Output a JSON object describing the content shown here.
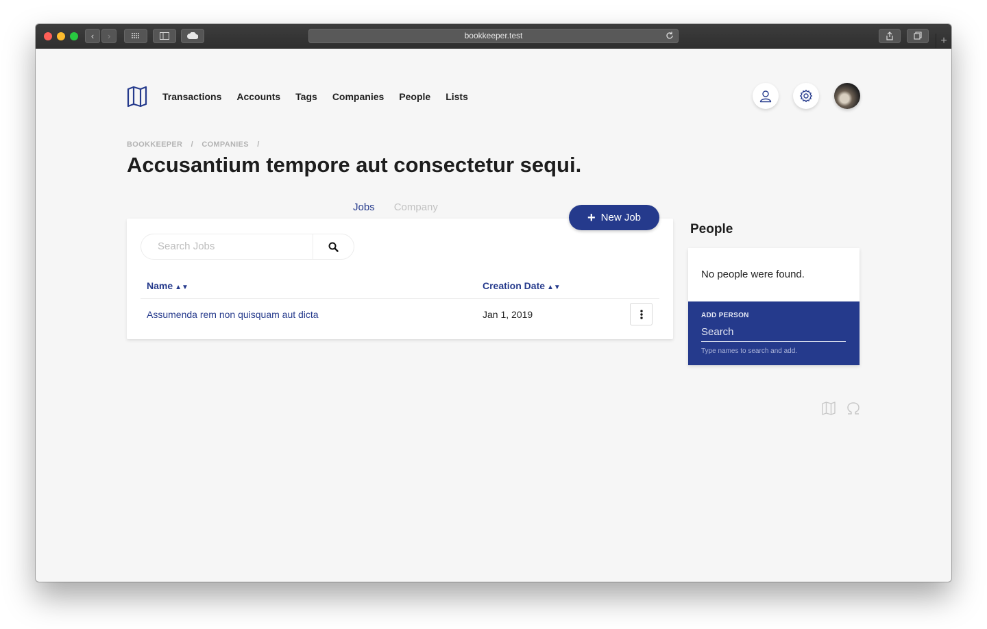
{
  "browser": {
    "url": "bookkeeper.test"
  },
  "nav": {
    "items": [
      "Transactions",
      "Accounts",
      "Tags",
      "Companies",
      "People",
      "Lists"
    ]
  },
  "breadcrumb": [
    "BOOKKEEPER",
    "/",
    "COMPANIES",
    "/"
  ],
  "page": {
    "title": "Accusantium tempore aut consectetur sequi."
  },
  "tabs": {
    "jobs": "Jobs",
    "company": "Company"
  },
  "actions": {
    "new_job": "New Job"
  },
  "jobs": {
    "search_placeholder": "Search Jobs",
    "columns": {
      "name": "Name",
      "creation_date": "Creation Date"
    },
    "rows": [
      {
        "name": "Assumenda rem non quisquam aut dicta",
        "date": "Jan 1, 2019"
      }
    ]
  },
  "people": {
    "title": "People",
    "empty": "No people were found.",
    "add_label": "ADD PERSON",
    "search_placeholder": "Search",
    "hint": "Type names to search and add."
  },
  "colors": {
    "brand": "#253a8c",
    "background": "#f6f6f6"
  },
  "icons": [
    "map-icon",
    "user-icon",
    "gear-icon",
    "search-icon",
    "more-vertical-icon",
    "omega-icon",
    "refresh-icon",
    "share-icon",
    "tabs-icon",
    "cloud-icon",
    "sidebar-icon",
    "grid-icon"
  ]
}
